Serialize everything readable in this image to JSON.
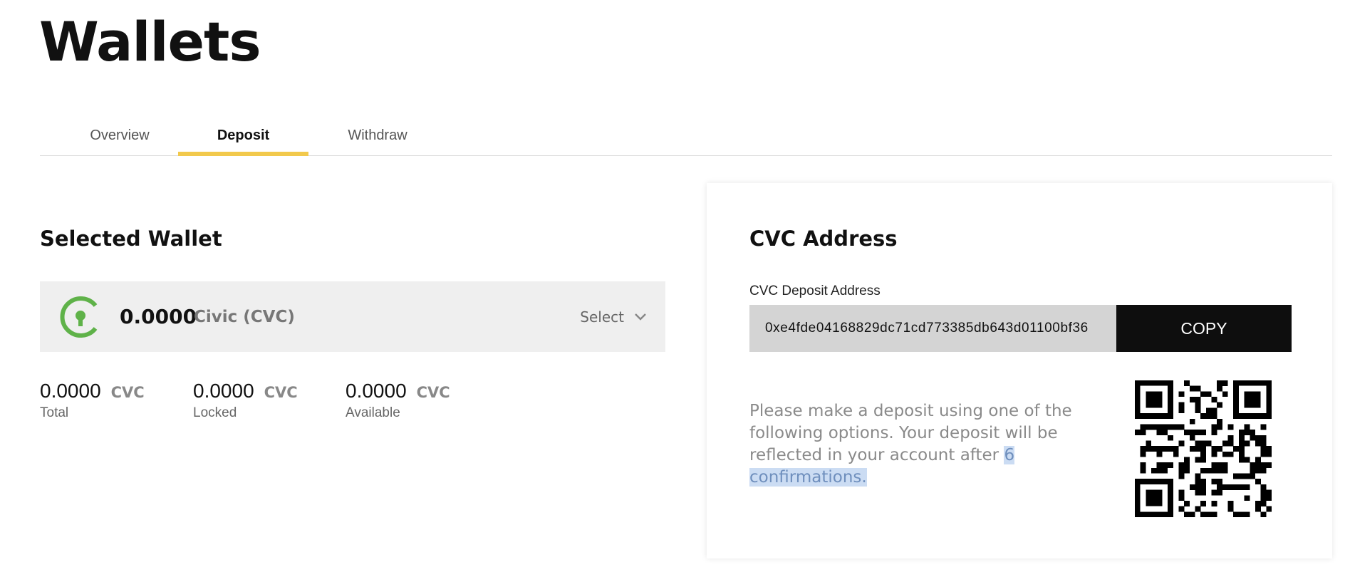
{
  "page": {
    "title": "Wallets"
  },
  "tabs": [
    {
      "label": "Overview",
      "active": false
    },
    {
      "label": "Deposit",
      "active": true
    },
    {
      "label": "Withdraw",
      "active": false
    }
  ],
  "selected_wallet": {
    "heading": "Selected Wallet",
    "balance": "0.0000",
    "coin_name": "Civic (CVC)",
    "select_label": "Select",
    "icon": "civic-logo-icon"
  },
  "stats": [
    {
      "value": "0.0000",
      "unit": "CVC",
      "label": "Total"
    },
    {
      "value": "0.0000",
      "unit": "CVC",
      "label": "Locked"
    },
    {
      "value": "0.0000",
      "unit": "CVC",
      "label": "Available"
    }
  ],
  "address_card": {
    "heading": "CVC Address",
    "field_label": "CVC Deposit Address",
    "address": "0xe4fde04168829dc71cd773385db643d01100bf36",
    "copy_label": "COPY",
    "deposit_text": "Please make a deposit using one of the following options. Your deposit will be reflected in your account after",
    "confirmations_text": "6 confirmations.",
    "qr_icon": "qr-code-icon"
  },
  "colors": {
    "accent": "#f2c94c",
    "civic_green": "#5fb249",
    "copy_button_bg": "#0e0e0e",
    "selection_highlight": "#cbdcf3"
  }
}
